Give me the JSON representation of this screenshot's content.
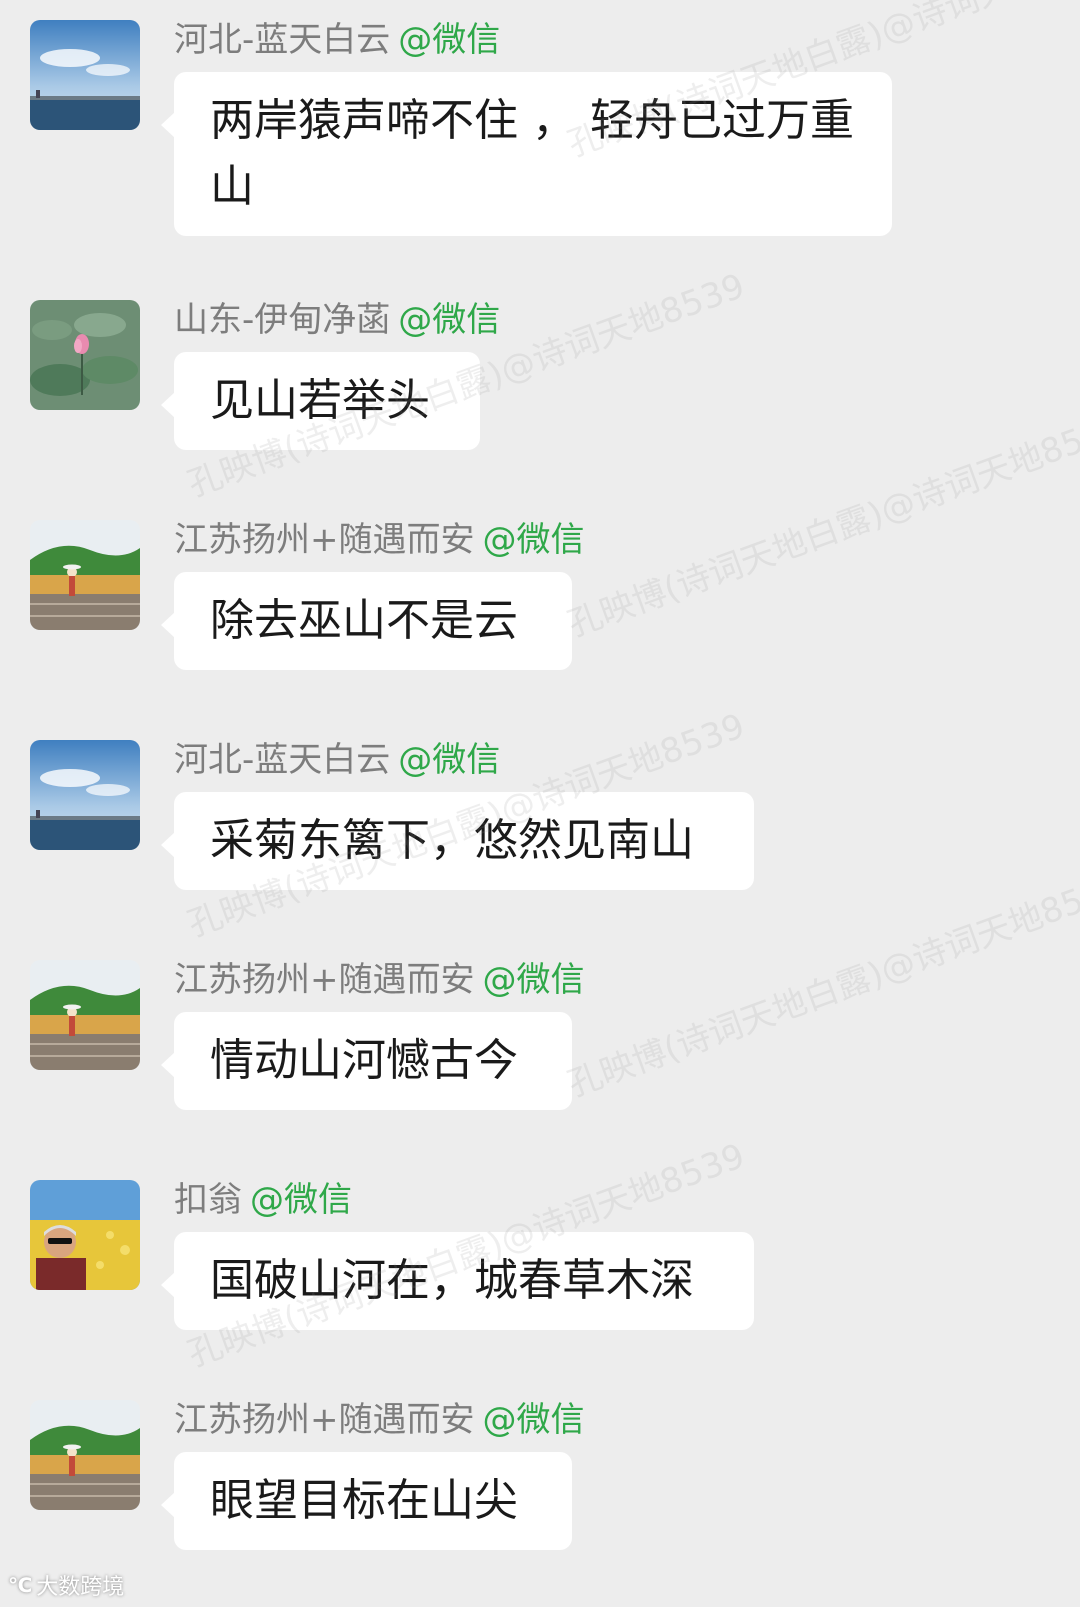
{
  "wechat_tag": "@微信",
  "messages": [
    {
      "sender": "河北-蓝天白云",
      "avatar": "sea-sky-avatar",
      "text": "两岸猿声啼不住 ， 轻舟已过万重山"
    },
    {
      "sender": "山东-伊甸净菡",
      "avatar": "lotus-avatar",
      "text": "见山若举头"
    },
    {
      "sender": "江苏扬州+随遇而安",
      "avatar": "mountain-boardwalk-avatar",
      "text": "除去巫山不是云"
    },
    {
      "sender": "河北-蓝天白云",
      "avatar": "sea-sky-avatar",
      "text": "采菊东篱下，悠然见南山"
    },
    {
      "sender": "江苏扬州+随遇而安",
      "avatar": "mountain-boardwalk-avatar",
      "text": "情动山河憾古今"
    },
    {
      "sender": "扣翁",
      "avatar": "man-flowers-avatar",
      "text": "国破山河在，城春草木深"
    },
    {
      "sender": "江苏扬州+随遇而安",
      "avatar": "mountain-boardwalk-avatar",
      "text": "眼望目标在山尖"
    }
  ],
  "watermarks": [
    "孔映博(诗词天地白露)@诗词天地8539",
    "孔映博(诗词天地白露)@诗词天地8539",
    "孔映博(诗词天地白露)@诗词天地8539",
    "孔映博(诗词天地白露)@诗词天地8539",
    "孔映博(诗词天地白露)@诗词天地8539",
    "孔映博(诗词天地白露)@诗词天地8539"
  ],
  "corner_logo": "大数跨境",
  "colors": {
    "background": "#ededed",
    "bubble": "#ffffff",
    "sender_name": "#7d7d7d",
    "wechat_tag": "#2fa849"
  }
}
